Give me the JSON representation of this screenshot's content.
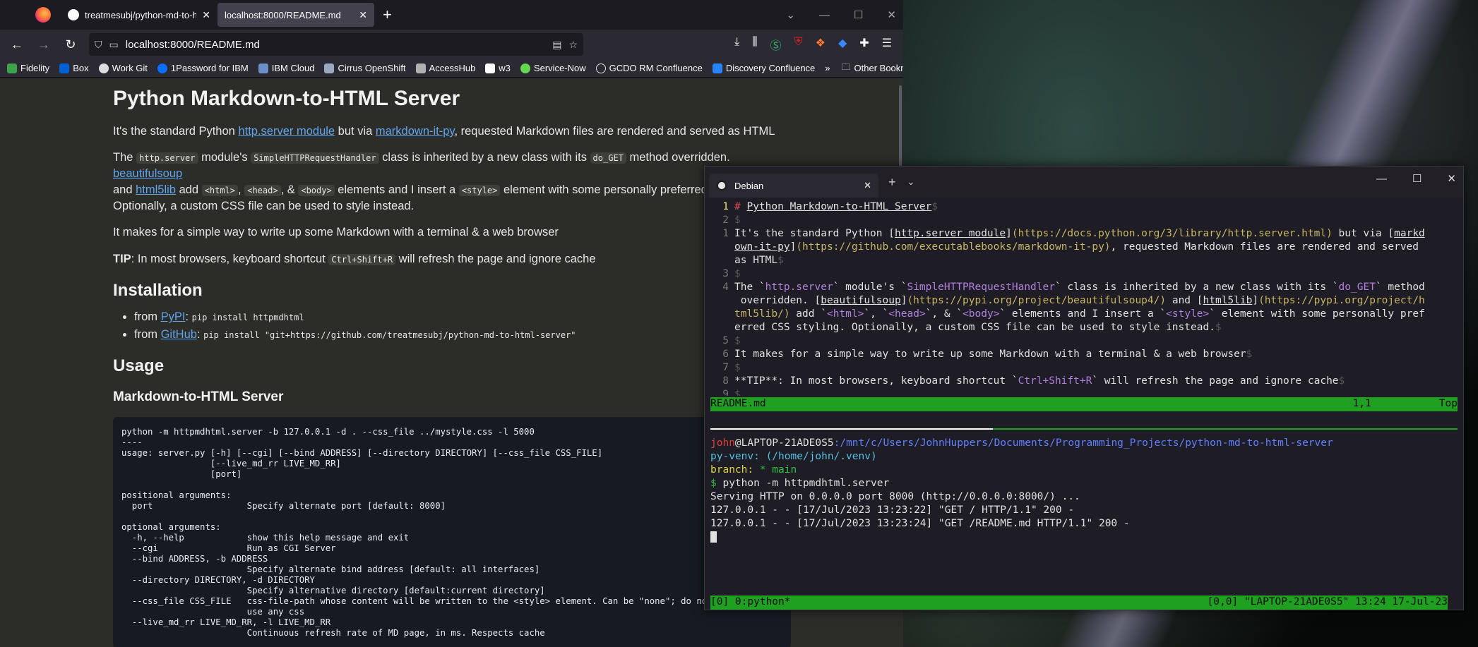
{
  "browser": {
    "tabs": [
      {
        "title": "treatmesubj/python-md-to-htm",
        "active": false
      },
      {
        "title": "localhost:8000/README.md",
        "active": true
      }
    ],
    "url": "localhost:8000/README.md",
    "bookmarks": [
      "Fidelity",
      "Box",
      "Work Git",
      "1Password for IBM",
      "IBM Cloud",
      "Cirrus OpenShift",
      "AccessHub",
      "w3",
      "Service-Now",
      "GCDO RM Confluence",
      "Discovery Confluence"
    ],
    "other_bookmarks": "Other Bookmarks"
  },
  "readme": {
    "title": "Python Markdown-to-HTML Server",
    "p1": {
      "a": "It's the standard Python ",
      "link1": "http.server module",
      "b": " but via ",
      "link2": "markdown-it-py",
      "c": ", requested Markdown files are rendered and served as HTML"
    },
    "p2": {
      "a": "The ",
      "code1": "http.server",
      "b": " module's ",
      "code2": "SimpleHTTPRequestHandler",
      "c": " class is inherited by a new class with its ",
      "code3": "do_GET",
      "d": " method overridden. ",
      "link1": "beautifulsoup",
      "e": " and ",
      "link2": "html5lib",
      "f": " add ",
      "code4": "<html>",
      "g": ", ",
      "code5": "<head>",
      "h": ", & ",
      "code6": "<body>",
      "i": " elements and I insert a ",
      "code7": "<style>",
      "j": " element with some personally preferred CSS styling.",
      "k": "Optionally, a custom CSS file can be used to style instead."
    },
    "p3": "It makes for a simple way to write up some Markdown with a terminal & a web browser",
    "tip": {
      "label": "TIP",
      "a": ": In most browsers, keyboard shortcut ",
      "code": "Ctrl+Shift+R",
      "b": " will refresh the page and ignore cache"
    },
    "h_install": "Installation",
    "install": [
      {
        "a": "from ",
        "link": "PyPI",
        "b": ": ",
        "cmd": "pip install httpmdhtml"
      },
      {
        "a": "from ",
        "link": "GitHub",
        "b": ": ",
        "cmd": "pip install \"git+https://github.com/treatmesubj/python-md-to-html-server\""
      }
    ],
    "h_usage": "Usage",
    "h_server": "Markdown-to-HTML Server",
    "usage_code": "python -m httpmdhtml.server -b 127.0.0.1 -d . --css_file ../mystyle.css -l 5000\n----\nusage: server.py [-h] [--cgi] [--bind ADDRESS] [--directory DIRECTORY] [--css_file CSS_FILE]\n                 [--live_md_rr LIVE_MD_RR]\n                 [port]\n\npositional arguments:\n  port                  Specify alternate port [default: 8000]\n\noptional arguments:\n  -h, --help            show this help message and exit\n  --cgi                 Run as CGI Server\n  --bind ADDRESS, -b ADDRESS\n                        Specify alternate bind address [default: all interfaces]\n  --directory DIRECTORY, -d DIRECTORY\n                        Specify alternative directory [default:current directory]\n  --css_file CSS_FILE   css-file-path whose content will be written to the <style> element. Can be \"none\"; do not\n                        use any css\n  --live_md_rr LIVE_MD_RR, -l LIVE_MD_RR\n                        Continuous refresh rate of MD page, in ms. Respects cache"
  },
  "terminal": {
    "tab_title": "Debian",
    "vim": {
      "l1": "Python Markdown-to-HTML Server",
      "l2a": "It's the standard Python [",
      "l2_link1": "http.server module",
      "l2_url1": "(https://docs.python.org/3/library/http.server.html)",
      "l2b": " but via [",
      "l2_link2a": "markd",
      "l2_link2b": "own-it-py",
      "l2_url2": "(https://github.com/executablebooks/markdown-it-py)",
      "l2c": ", requested Markdown files are rendered and served",
      "l2d": "as HTML",
      "l4a": "The `",
      "l4_c1": "http.server",
      "l4b": "` module's `",
      "l4_c2": "SimpleHTTPRequestHandler",
      "l4c": "` class is inherited by a new class with its `",
      "l4_c3": "do_GET",
      "l4d": "` method",
      "l4e": " overridden. [",
      "l4_link1": "beautifulsoup",
      "l4_url1": "(https://pypi.org/project/beautifulsoup4/)",
      "l4f": " and [",
      "l4_link2": "html5lib",
      "l4_url2a": "(https://pypi.org/project/h",
      "l4_url2b": "tml5lib/)",
      "l4g": " add `",
      "l4_c4": "<html>",
      "l4h": "`, `",
      "l4_c5": "<head>",
      "l4i": "`, & `",
      "l4_c6": "<body>",
      "l4j": "` elements and I insert a `",
      "l4_c7": "<style>",
      "l4k": "` element with some personally pref",
      "l4l": "erred CSS styling. Optionally, a custom CSS file can be used to style instead.",
      "l6": "It makes for a simple way to write up some Markdown with a terminal & a web browser",
      "l8a": "**TIP**: In most browsers, keyboard shortcut `",
      "l8_c": "Ctrl+Shift+R",
      "l8b": "` will refresh the page and ignore cache",
      "status_file": "README.md",
      "status_pos": "1,1",
      "status_scroll": "Top"
    },
    "shell": {
      "user": "john",
      "host": "@LAPTOP-21ADE0S5",
      "path": ":/mnt/c/Users/JohnHuppers/Documents/Programming_Projects/python-md-to-html-server",
      "venv": "py-venv: (/home/john/.venv)",
      "branch_label": "branch:",
      "branch": " * main",
      "prompt": "$ ",
      "command": "python -m httpmdhtml.server",
      "out1": "Serving HTTP on 0.0.0.0 port 8000 (http://0.0.0.0:8000/) ...",
      "out2": "127.0.0.1 - - [17/Jul/2023 13:23:22] \"GET / HTTP/1.1\" 200 -",
      "out3": "127.0.0.1 - - [17/Jul/2023 13:23:24] \"GET /README.md HTTP/1.1\" 200 -"
    },
    "tmux": {
      "left": "[0] 0:python*",
      "right": "[0,0] \"LAPTOP-21ADE0S5\" 13:24 17-Jul-23"
    }
  }
}
